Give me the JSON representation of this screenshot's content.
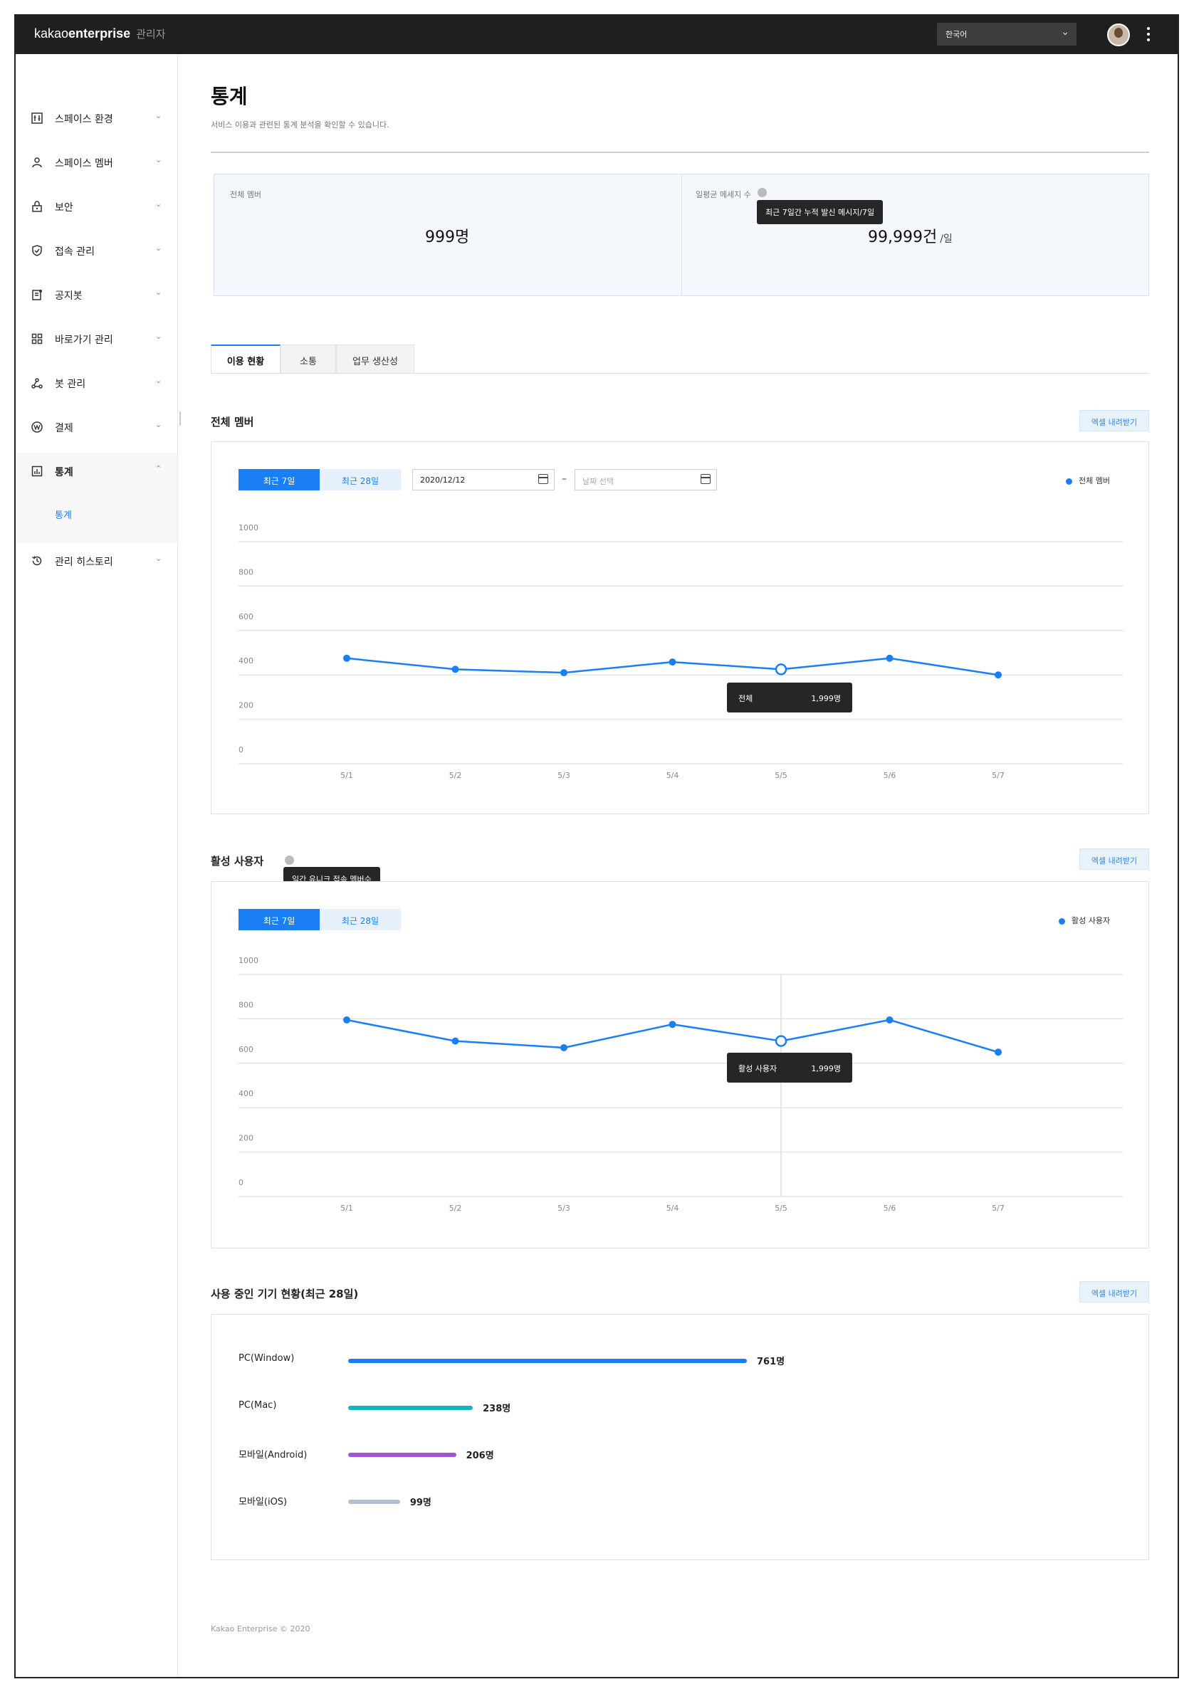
{
  "header": {
    "brand_light": "kakao",
    "brand_bold": "enterprise",
    "brand_admin": "관리자",
    "language": "한국어"
  },
  "sidebar": {
    "items": [
      {
        "label": "스페이스 환경",
        "icon": "settings-sliders-icon"
      },
      {
        "label": "스페이스 멤버",
        "icon": "person-icon"
      },
      {
        "label": "보안",
        "icon": "lock-icon"
      },
      {
        "label": "접속 관리",
        "icon": "shield-icon"
      },
      {
        "label": "공지봇",
        "icon": "notice-icon"
      },
      {
        "label": "바로가기 관리",
        "icon": "grid-icon"
      },
      {
        "label": "봇 관리",
        "icon": "bot-nodes-icon"
      },
      {
        "label": "결제",
        "icon": "won-icon"
      },
      {
        "label": "통계",
        "icon": "bar-chart-icon"
      },
      {
        "label": "관리 히스토리",
        "icon": "history-icon"
      }
    ],
    "active_sub": "통계"
  },
  "page": {
    "title": "통계",
    "description": "서비스 이용과 관련된 통계 분석을 확인할 수 있습니다."
  },
  "stats": {
    "total_members_label": "전체 멤버",
    "total_members_value": "999명",
    "avg_messages_label": "일평균 메세지 수",
    "avg_messages_tooltip": "최근 7일간 누적 발신 메시지/7일",
    "avg_messages_value": "99,999건",
    "avg_messages_unit": "/일"
  },
  "tabs": [
    "이용 현황",
    "소통",
    "업무 생산성"
  ],
  "excel_label": "엑셀 내려받기",
  "section_members": {
    "title": "전체 멤버",
    "seg_7": "최근 7일",
    "seg_28": "최근 28일",
    "date_start": "2020/12/12",
    "date_end_placeholder": "날짜 선택",
    "date_separator": "–",
    "legend": "전체 멤버",
    "tooltip_label": "전체",
    "tooltip_value": "1,999명"
  },
  "section_active": {
    "title": "활성 사용자",
    "info_tooltip": "일간 유니크 접속 멤버수",
    "seg_7": "최근 7일",
    "seg_28": "최근 28일",
    "legend": "활성 사용자",
    "tooltip_label": "활성 사용자",
    "tooltip_value": "1,999명"
  },
  "section_devices": {
    "title": "사용 중인 기기 현황(최근 28일)"
  },
  "chart_data": [
    {
      "type": "line",
      "categories": [
        "5/1",
        "5/2",
        "5/3",
        "5/4",
        "5/5",
        "5/6",
        "5/7"
      ],
      "series": [
        {
          "name": "전체 멤버",
          "values": [
            475,
            425,
            410,
            458,
            425,
            475,
            400
          ],
          "color": "#1a7ff5"
        }
      ],
      "ylim": [
        0,
        1000
      ],
      "yticks": [
        0,
        200,
        400,
        600,
        800,
        1000
      ],
      "grid": true,
      "legend": "top-right"
    },
    {
      "type": "line",
      "categories": [
        "5/1",
        "5/2",
        "5/3",
        "5/4",
        "5/5",
        "5/6",
        "5/7"
      ],
      "series": [
        {
          "name": "활성 사용자",
          "values": [
            795,
            700,
            670,
            775,
            700,
            795,
            650
          ],
          "color": "#1a7ff5"
        }
      ],
      "ylim": [
        0,
        1000
      ],
      "yticks": [
        0,
        200,
        400,
        600,
        800,
        1000
      ],
      "grid": true,
      "legend": "top-right"
    },
    {
      "type": "bar",
      "orientation": "horizontal",
      "categories": [
        "PC(Window)",
        "PC(Mac)",
        "모바일(Android)",
        "모바일(iOS)"
      ],
      "values": [
        761,
        238,
        206,
        99
      ],
      "value_labels": [
        "761명",
        "238명",
        "206명",
        "99명"
      ],
      "colors": [
        "#1a7ff5",
        "#16b3c3",
        "#a055d6",
        "#b4c0d0"
      ]
    }
  ],
  "footer": "Kakao Enterprise © 2020"
}
